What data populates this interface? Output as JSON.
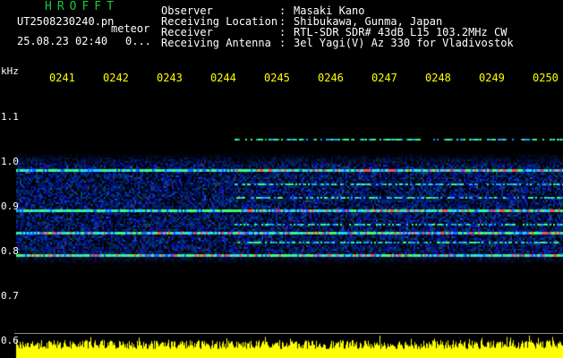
{
  "header": {
    "app_title": "HROFFT",
    "filename": "UT2508230240.pn",
    "type_label": "meteor",
    "datetime": "25.08.23 02:40",
    "counter": "0..."
  },
  "info": [
    {
      "label": "Observer",
      "value": "Masaki Kano"
    },
    {
      "label": "Receiving Location",
      "value": "Shibukawa, Gunma, Japan"
    },
    {
      "label": "Receiver",
      "value": "RTL-SDR SDR# 43dB L15 103.2MHz CW"
    },
    {
      "label": "Receiving Antenna",
      "value": "3el Yagi(V) Az 330 for Vladivostok"
    }
  ],
  "axis": {
    "unit": "kHz",
    "time_labels": [
      "0241",
      "0242",
      "0243",
      "0244",
      "0245",
      "0246",
      "0247",
      "0248",
      "0249",
      "0250"
    ],
    "freq_labels": [
      "1.1",
      "1.0",
      "0.9",
      "0.8",
      "0.7",
      "0.6"
    ]
  },
  "colors": {
    "title": "#19c83c",
    "text": "#ffffff",
    "time_axis": "#ffff00",
    "background": "#000000",
    "noise_floor": "#ffff00"
  },
  "chart_data": {
    "type": "heatmap",
    "title": "HROFFT",
    "xlabel": "",
    "ylabel": "kHz",
    "x_ticks": [
      "0241",
      "0242",
      "0243",
      "0244",
      "0245",
      "0246",
      "0247",
      "0248",
      "0249",
      "0250"
    ],
    "y_ticks": [
      1.1,
      1.0,
      0.9,
      0.8,
      0.7,
      0.6
    ],
    "ylim": [
      0.6,
      1.2
    ],
    "signal_band_khz": [
      0.77,
      1.02
    ],
    "carrier_lines_khz": [
      0.79,
      0.84,
      0.89,
      0.98
    ]
  }
}
